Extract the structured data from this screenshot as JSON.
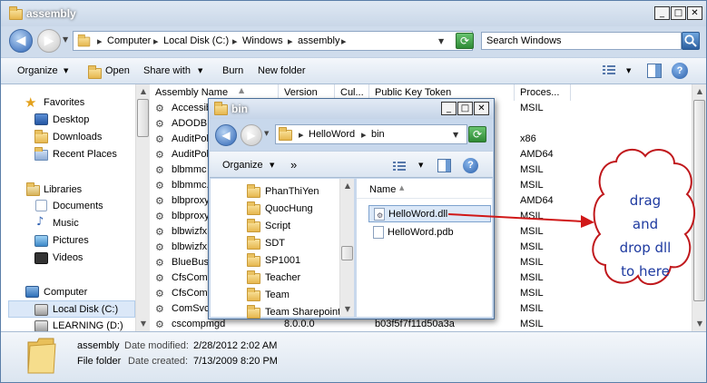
{
  "window": {
    "title": "assembly",
    "min": "_",
    "max": "□",
    "close": "✕"
  },
  "address": {
    "back": "◀",
    "forward": "▶",
    "crumbs": [
      "Computer",
      "Local Disk (C:)",
      "Windows",
      "assembly"
    ],
    "sep": "▸",
    "search_placeholder": "Search Windows"
  },
  "toolbar": {
    "organize": "Organize",
    "open": "Open",
    "share": "Share with",
    "burn": "Burn",
    "new_folder": "New folder"
  },
  "nav": {
    "favorites": "Favorites",
    "desktop": "Desktop",
    "downloads": "Downloads",
    "recent": "Recent Places",
    "libraries": "Libraries",
    "documents": "Documents",
    "music": "Music",
    "pictures": "Pictures",
    "videos": "Videos",
    "computer": "Computer",
    "local_disk": "Local Disk (C:)",
    "learning": "LEARNING (D:)"
  },
  "columns": {
    "name": "Assembly Name",
    "version": "Version",
    "culture": "Cul...",
    "token": "Public Key Token",
    "proc": "Proces..."
  },
  "rows": [
    {
      "name": "Accessib",
      "version": "",
      "token": "",
      "proc": "MSIL"
    },
    {
      "name": "ADODB",
      "version": "",
      "token": "",
      "proc": ""
    },
    {
      "name": "AuditPol",
      "version": "",
      "token": "",
      "proc": "x86"
    },
    {
      "name": "AuditPol",
      "version": "",
      "token": "",
      "proc": "AMD64"
    },
    {
      "name": "blbmmc",
      "version": "",
      "token": "",
      "proc": "MSIL"
    },
    {
      "name": "blbmmc.",
      "version": "",
      "token": "",
      "proc": "MSIL"
    },
    {
      "name": "blbproxy",
      "version": "",
      "token": "",
      "proc": "AMD64"
    },
    {
      "name": "blbproxy",
      "version": "",
      "token": "",
      "proc": "MSIL"
    },
    {
      "name": "blbwizfx",
      "version": "",
      "token": "",
      "proc": "MSIL"
    },
    {
      "name": "blbwizfx",
      "version": "",
      "token": "",
      "proc": "MSIL"
    },
    {
      "name": "BlueBusi",
      "version": "",
      "token": "",
      "proc": "MSIL"
    },
    {
      "name": "CfsComr",
      "version": "",
      "token": "",
      "proc": "MSIL"
    },
    {
      "name": "CfsComr",
      "version": "",
      "token": "",
      "proc": "MSIL"
    },
    {
      "name": "ComSvcC",
      "version": "",
      "token": "",
      "proc": "MSIL"
    },
    {
      "name": "cscompmgd",
      "version": "8.0.0.0",
      "token": "b03f5f7f11d50a3a",
      "proc": "MSIL"
    }
  ],
  "details": {
    "name": "assembly",
    "modified_label": "Date modified:",
    "modified": "2/28/2012 2:02 AM",
    "type": "File folder",
    "created_label": "Date created:",
    "created": "7/13/2009 8:20 PM"
  },
  "bin": {
    "title": "bin",
    "crumbs": [
      "HelloWord",
      "bin"
    ],
    "organize": "Organize",
    "more": "»",
    "folders": [
      "PhanThiYen",
      "QuocHung",
      "Script",
      "SDT",
      "SP1001",
      "Teacher",
      "Team",
      "Team Sharepoint"
    ],
    "col_name": "Name",
    "files": [
      "HelloWord.dll",
      "HelloWord.pdb"
    ]
  },
  "callout": {
    "lines": [
      "drag",
      "and",
      "drop dll",
      "to here"
    ]
  },
  "colors": {
    "callout_text": "#1e3aa0",
    "arrow": "#d01818",
    "selection": "#dbe8f8"
  }
}
